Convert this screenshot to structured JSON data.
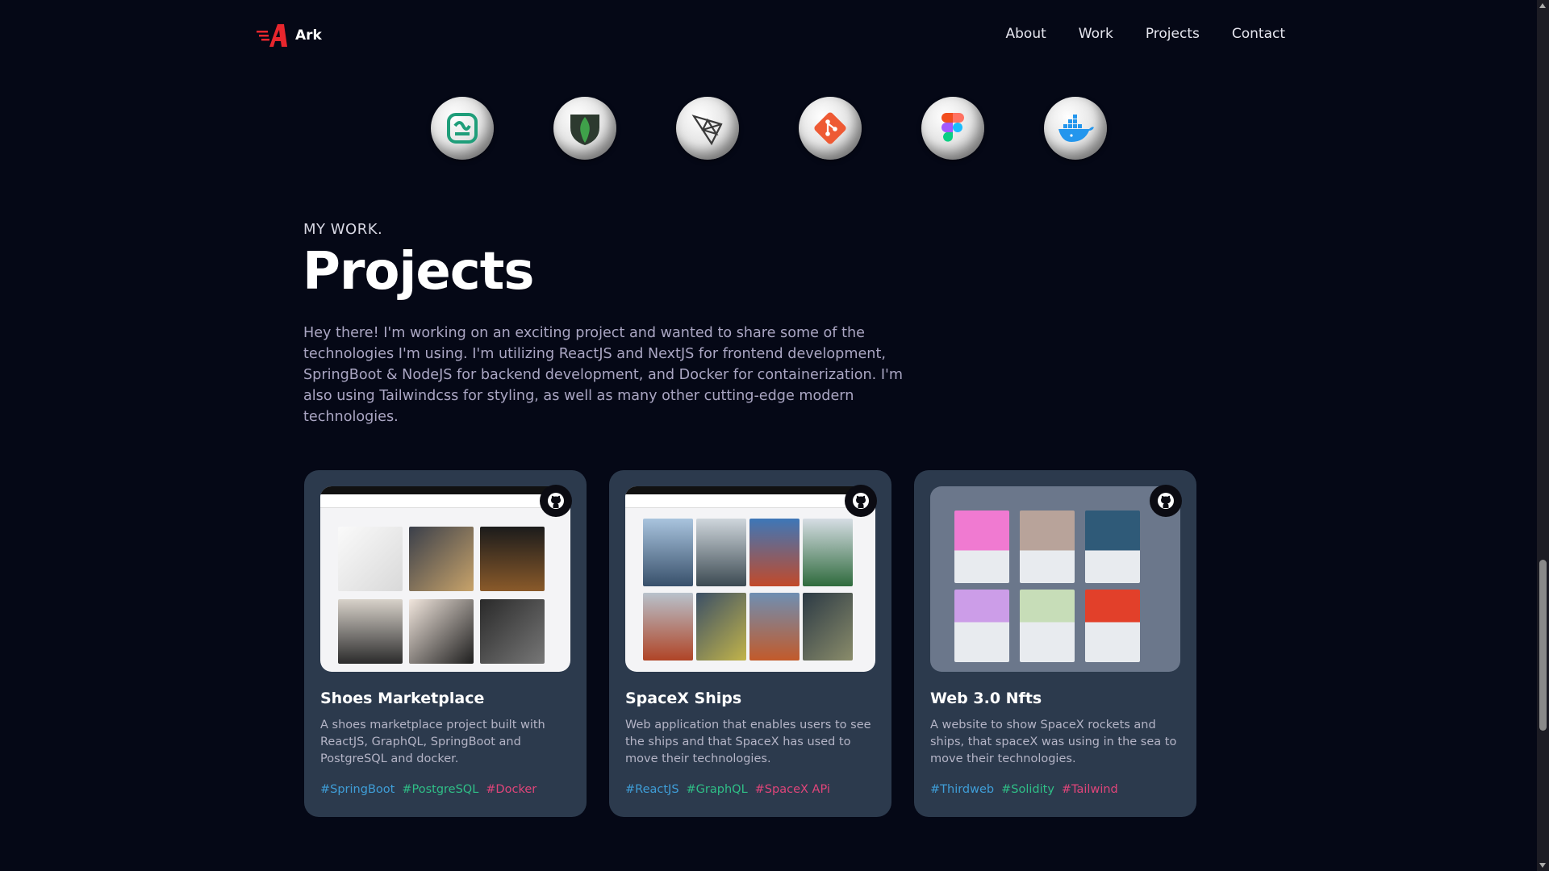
{
  "nav": {
    "brand": "Ark",
    "links": [
      "About",
      "Work",
      "Projects",
      "Contact"
    ]
  },
  "tech_icons": [
    "tailwind-ish-icon",
    "mongodb-icon",
    "threejs-icon",
    "git-icon",
    "figma-icon",
    "docker-icon"
  ],
  "section": {
    "subtitle": "MY WORK.",
    "title": "Projects",
    "intro": "Hey there! I'm working on an exciting project and wanted to share some of the technologies I'm using. I'm utilizing ReactJS and NextJS for frontend development, SpringBoot & NodeJS for backend development, and Docker for containerization. I'm also using Tailwindcss for styling, as well as many other cutting-edge modern technologies."
  },
  "projects": [
    {
      "title": "Shoes Marketplace",
      "description": "A shoes marketplace project built with ReactJS, GraphQL, SpringBoot and PostgreSQL and docker.",
      "tags": [
        "#SpringBoot",
        "#PostgreSQL",
        "#Docker"
      ]
    },
    {
      "title": "SpaceX Ships",
      "description": "Web application that enables users to see the ships and that SpaceX has used to move their technologies.",
      "tags": [
        "#ReactJS",
        "#GraphQL",
        "#SpaceX APi"
      ]
    },
    {
      "title": "Web 3.0 Nfts",
      "description": "A website to show SpaceX rockets and ships, that spaceX was using in the sea to move their technologies.",
      "tags": [
        "#Thirdweb",
        "#Solidity",
        "#Tailwind"
      ]
    }
  ],
  "colors": {
    "background": "#050816",
    "card": "#2c3a4d",
    "tag_blue": "#3f9ed8",
    "tag_green": "#2fbf87",
    "tag_pink": "#e0457a",
    "brand_red": "#e8262d"
  }
}
